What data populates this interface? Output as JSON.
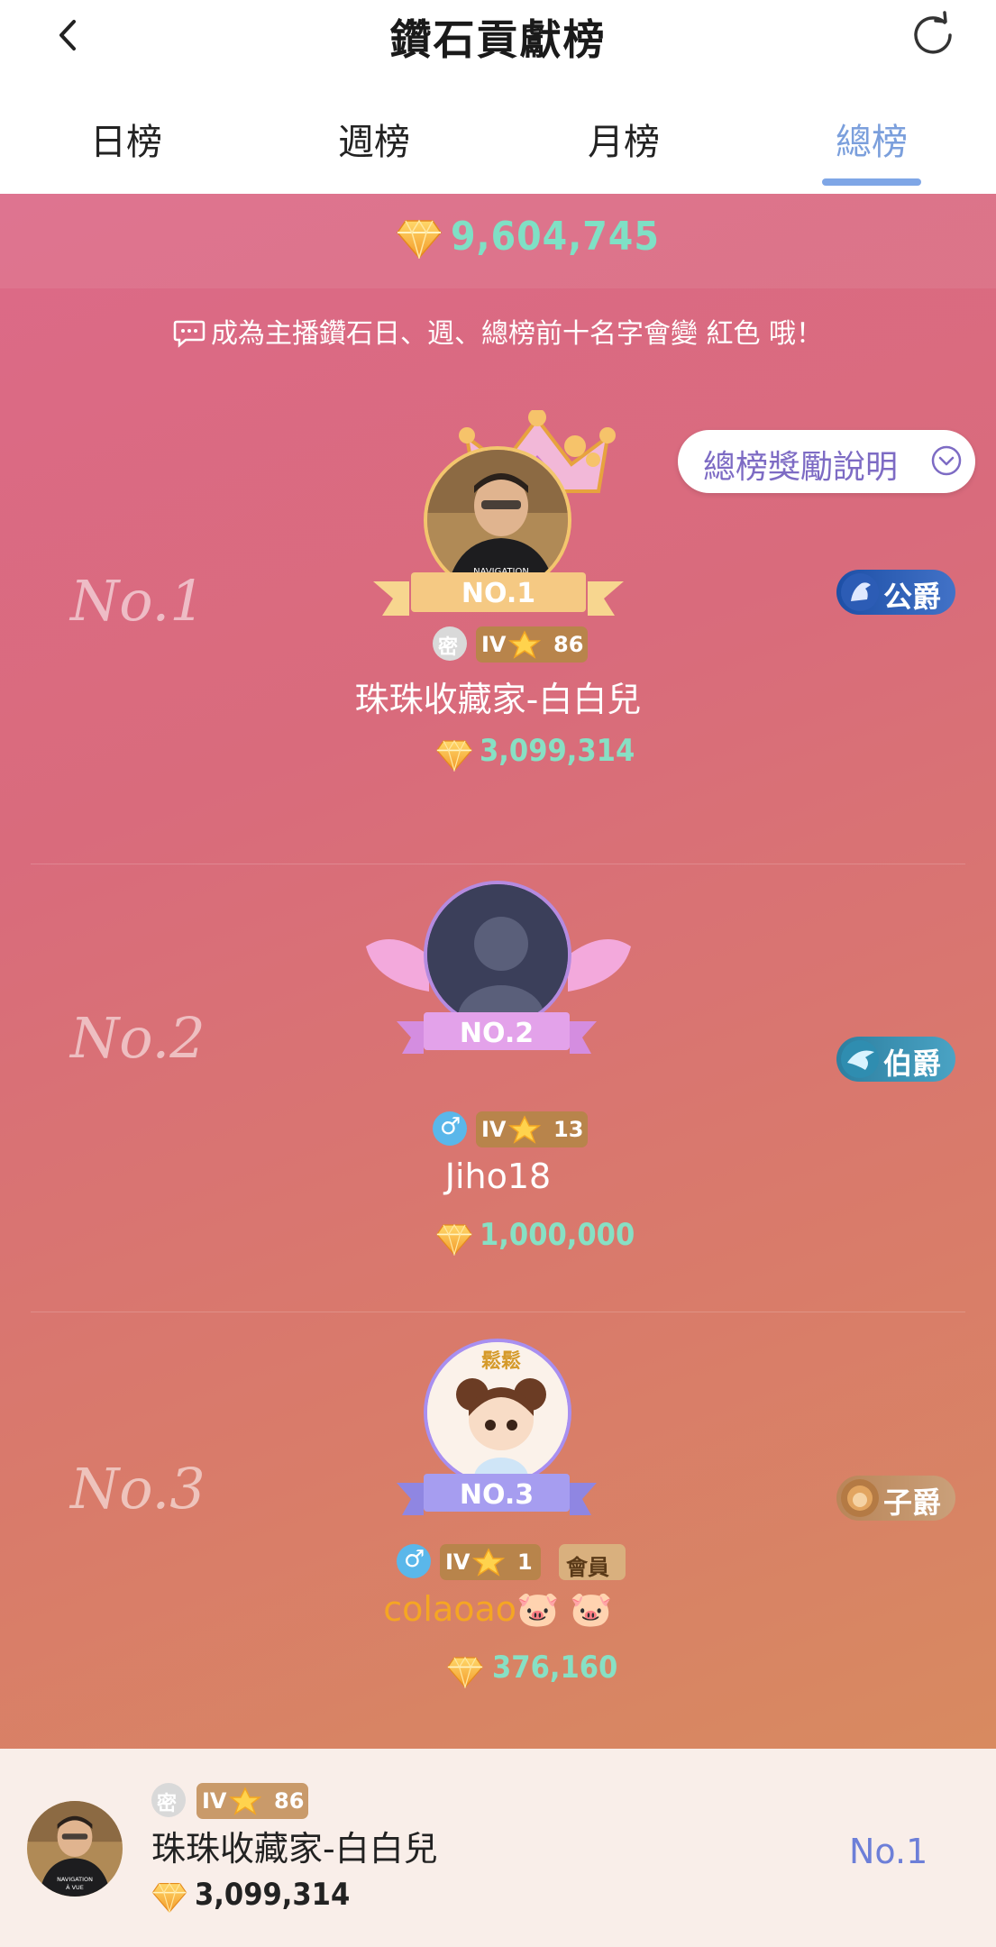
{
  "header": {
    "title": "鑽石貢獻榜"
  },
  "tabs": [
    {
      "label": "日榜",
      "active": false
    },
    {
      "label": "週榜",
      "active": false
    },
    {
      "label": "月榜",
      "active": false
    },
    {
      "label": "總榜",
      "active": true
    }
  ],
  "total": {
    "value": "9,604,745"
  },
  "notice": {
    "text": "成為主播鑽石日、週、總榜前十名字會變 紅色 哦！"
  },
  "reward_button": {
    "label": "總榜獎勵說明"
  },
  "ranks": [
    {
      "mark": "No.1",
      "ribbon": "NO.1",
      "title": "公爵",
      "badge_symbol": "密",
      "tier": "IV",
      "level": "86",
      "name": "珠珠收藏家-白白兒",
      "amount": "3,099,314"
    },
    {
      "mark": "No.2",
      "ribbon": "NO.2",
      "title": "伯爵",
      "badge_symbol": "♂",
      "tier": "IV",
      "level": "13",
      "name": "Jiho18",
      "amount": "1,000,000"
    },
    {
      "mark": "No.3",
      "ribbon": "NO.3",
      "title": "子爵",
      "badge_symbol": "♂",
      "tier": "IV",
      "level": "1",
      "member": "會員",
      "name": "colaoao🐷 🐷",
      "amount": "376,160",
      "frame_text": "鬆鬆"
    }
  ],
  "me": {
    "badge_symbol": "密",
    "tier": "IV",
    "level": "86",
    "name": "珠珠收藏家-白白兒",
    "amount": "3,099,314",
    "rank": "No.1"
  },
  "avatar_tshirt": [
    "NAVIGATION",
    "À VUE"
  ],
  "colors": {
    "accent_tab": "#7b9fdc",
    "amount": "#87e0c4",
    "rank_text": "#6d7fd8",
    "name_rank3": "#f5a623"
  }
}
